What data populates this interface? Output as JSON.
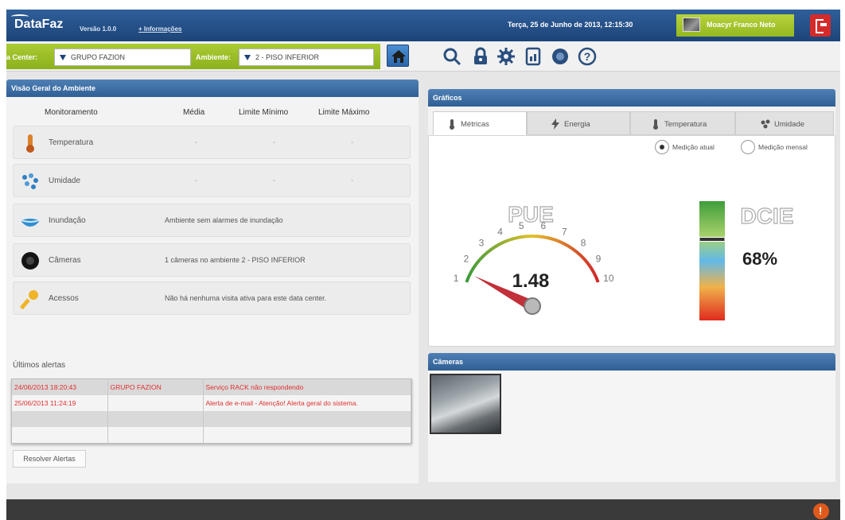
{
  "header": {
    "logo": "DataFaz",
    "version": "Versão 1.0.0",
    "more_info": "+ Informações",
    "datetime": "Terça, 25 de Junho de 2013, 12:15:30",
    "user_name": "Moacyr Franco Neto"
  },
  "toolbar": {
    "datacenter_label": "a Center:",
    "datacenter_value": "GRUPO FAZION",
    "ambiente_label": "Ambiente:",
    "ambiente_value": "2 - PISO INFERIOR",
    "icons": [
      "home-icon",
      "search-icon",
      "lock-icon",
      "gear-icon",
      "report-icon",
      "camera-icon",
      "help-icon"
    ]
  },
  "overview": {
    "title": "Visão Geral do Ambiente",
    "columns": [
      "Monitoramento",
      "Média",
      "Limite Mínimo",
      "Limite Máximo"
    ],
    "rows": [
      {
        "name": "Temperatura",
        "icon": "thermometer-icon",
        "values": [
          "-",
          "-",
          "-"
        ]
      },
      {
        "name": "Umidade",
        "icon": "humidity-icon",
        "values": [
          "-",
          "-",
          "-"
        ]
      },
      {
        "name": "Inundação",
        "icon": "flood-icon",
        "text": "Ambiente sem alarmes de inundação"
      },
      {
        "name": "Câmeras",
        "icon": "camera-icon",
        "text": "1 câmeras no ambiente 2 - PISO INFERIOR"
      },
      {
        "name": "Acessos",
        "icon": "key-icon",
        "text": "Não há nenhuma visita ativa para este data center."
      }
    ]
  },
  "alerts": {
    "label": "Últimos alertas",
    "rows": [
      [
        "24/06/2013 18:20:43",
        "GRUPO FAZION",
        "Serviço RACK não respondendo"
      ],
      [
        "25/06/2013 11:24:19",
        "",
        "Alerta de e-mail - Atenção! Alerta geral do sistema."
      ],
      [
        "",
        "",
        ""
      ],
      [
        "",
        "",
        ""
      ]
    ],
    "resolve_button": "Resolver Alertas"
  },
  "charts": {
    "title": "Gráficos",
    "tabs": [
      {
        "label": "Métricas",
        "icon": "thermometer-icon",
        "active": true
      },
      {
        "label": "Energia",
        "icon": "lightning-icon",
        "active": false
      },
      {
        "label": "Temperatura",
        "icon": "thermometer-icon",
        "active": false
      },
      {
        "label": "Umidade",
        "icon": "humidity-icon",
        "active": false
      }
    ],
    "radio_options": [
      {
        "label": "Medição atual",
        "selected": true
      },
      {
        "label": "Medição mensal",
        "selected": false
      }
    ],
    "pue": {
      "label": "PUE",
      "value": "1.48",
      "numeric": 1.48,
      "ticks": [
        "1",
        "2",
        "3",
        "4",
        "5",
        "6",
        "7",
        "8",
        "9",
        "10"
      ],
      "min": 1,
      "max": 10
    },
    "dcie": {
      "label": "DCIE",
      "value": "68%",
      "level": 0.68
    }
  },
  "cameras": {
    "title": "Câmeras"
  },
  "colors": {
    "header_blue": "#1d4478",
    "accent_green": "#9cbf27",
    "alert_red": "#e0302e",
    "logout_red": "#d42a2a"
  }
}
